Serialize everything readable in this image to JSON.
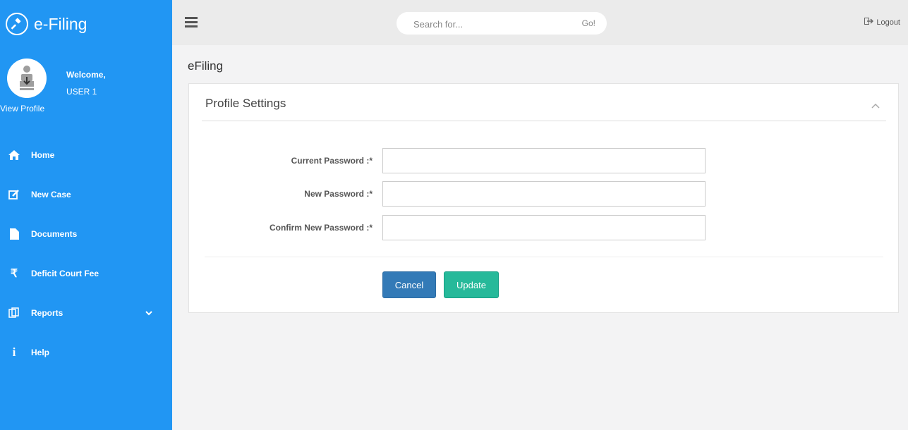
{
  "brand": {
    "name": "e-Filing",
    "logo_icon": "gavel-icon"
  },
  "profile": {
    "welcome": "Welcome,",
    "username": "USER 1",
    "view_profile": "View Profile"
  },
  "nav": [
    {
      "label": "Home",
      "icon": "home-icon"
    },
    {
      "label": "New Case",
      "icon": "edit-icon"
    },
    {
      "label": "Documents",
      "icon": "file-icon"
    },
    {
      "label": "Deficit Court Fee",
      "icon": "rupee-icon"
    },
    {
      "label": "Reports",
      "icon": "reports-icon",
      "has_submenu": true
    },
    {
      "label": "Help",
      "icon": "info-icon"
    }
  ],
  "topbar": {
    "search_placeholder": "Search for...",
    "search_button": "Go!",
    "logout": "Logout"
  },
  "page": {
    "title": "eFiling"
  },
  "panel": {
    "title": "Profile Settings",
    "fields": [
      {
        "label": "Current Password :*",
        "value": ""
      },
      {
        "label": "New Password :*",
        "value": ""
      },
      {
        "label": "Confirm New Password :*",
        "value": ""
      }
    ],
    "cancel_label": "Cancel",
    "update_label": "Update"
  },
  "colors": {
    "sidebar": "#2196f3",
    "cancel": "#337ab7",
    "update": "#26b99a"
  }
}
